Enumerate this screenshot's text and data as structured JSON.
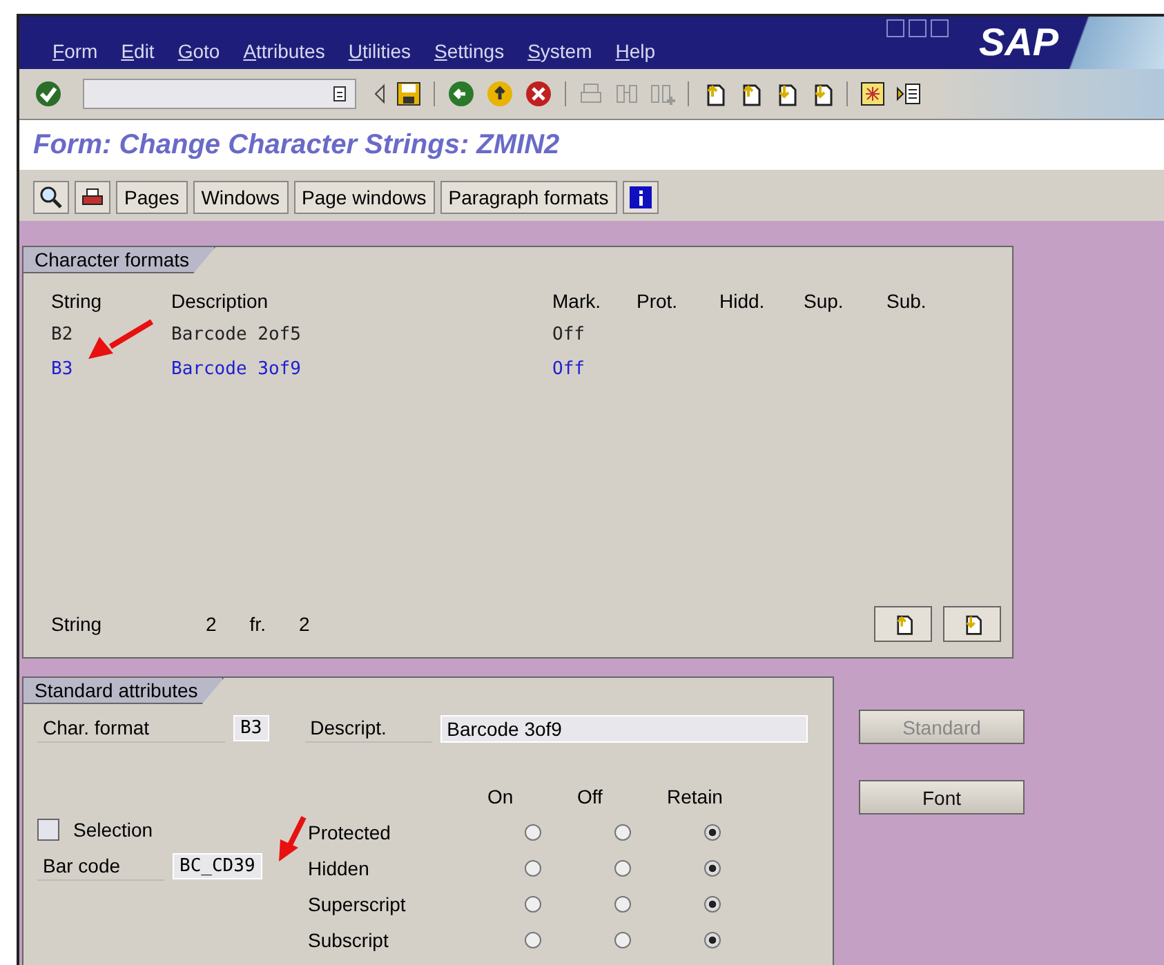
{
  "menu": [
    {
      "label": "Form"
    },
    {
      "label": "Edit"
    },
    {
      "label": "Goto"
    },
    {
      "label": "Attributes"
    },
    {
      "label": "Utilities"
    },
    {
      "label": "Settings"
    },
    {
      "label": "System"
    },
    {
      "label": "Help"
    }
  ],
  "logo": "SAP",
  "title": "Form: Change Character Strings: ZMIN2",
  "app_buttons": [
    {
      "label": "Pages"
    },
    {
      "label": "Windows"
    },
    {
      "label": "Page windows"
    },
    {
      "label": "Paragraph formats"
    }
  ],
  "char_formats": {
    "tab": "Character formats",
    "columns": [
      "String",
      "Description",
      "Mark.",
      "Prot.",
      "Hidd.",
      "Sup.",
      "Sub."
    ],
    "rows": [
      {
        "string": "B2",
        "description": "Barcode 2of5",
        "mark": "Off",
        "selected": false
      },
      {
        "string": "B3",
        "description": "Barcode 3of9",
        "mark": "Off",
        "selected": true
      }
    ],
    "footer": {
      "label": "String",
      "current": "2",
      "sep": "fr.",
      "total": "2"
    }
  },
  "attributes": {
    "tab": "Standard attributes",
    "char_format_label": "Char. format",
    "char_format": "B3",
    "descript_label": "Descript.",
    "descript": "Barcode 3of9",
    "selection": {
      "label": "Selection",
      "checked": false
    },
    "barcode_label": "Bar code",
    "barcode": "BC_CD39",
    "radio_columns": [
      "On",
      "Off",
      "Retain"
    ],
    "rows": [
      {
        "label": "Protected",
        "options": [
          {
            "selected": false
          },
          {
            "selected": false
          },
          {
            "selected": true
          }
        ]
      },
      {
        "label": "Hidden",
        "options": [
          {
            "selected": false
          },
          {
            "selected": false
          },
          {
            "selected": true
          }
        ]
      },
      {
        "label": "Superscript",
        "options": [
          {
            "selected": false
          },
          {
            "selected": false
          },
          {
            "selected": true
          }
        ]
      },
      {
        "label": "Subscript",
        "options": [
          {
            "selected": false
          },
          {
            "selected": false
          },
          {
            "selected": true
          }
        ]
      }
    ]
  },
  "side_buttons": [
    {
      "label": "Standard",
      "disabled": true
    },
    {
      "label": "Font",
      "disabled": false
    }
  ]
}
